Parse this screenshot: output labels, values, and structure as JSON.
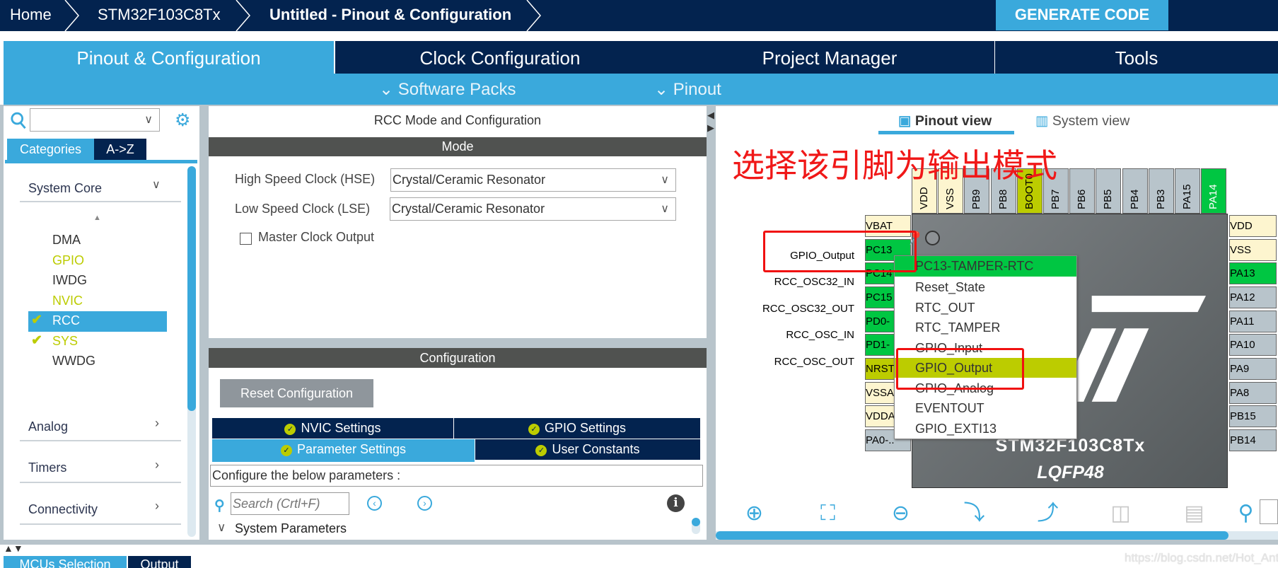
{
  "breadcrumb": [
    "Home",
    "STM32F103C8Tx",
    "Untitled - Pinout & Configuration"
  ],
  "generate_label": "GENERATE CODE",
  "main_tabs": [
    "Pinout & Configuration",
    "Clock Configuration",
    "Project Manager",
    "Tools"
  ],
  "sub_menus": [
    "Software Packs",
    "Pinout"
  ],
  "sidebar": {
    "search_value": "",
    "tabs": [
      "Categories",
      "A->Z"
    ],
    "group": "System Core",
    "items": [
      {
        "label": "DMA",
        "state": "normal"
      },
      {
        "label": "GPIO",
        "state": "warn"
      },
      {
        "label": "IWDG",
        "state": "normal"
      },
      {
        "label": "NVIC",
        "state": "warn"
      },
      {
        "label": "RCC",
        "state": "selected-checked"
      },
      {
        "label": "SYS",
        "state": "checked"
      },
      {
        "label": "WWDG",
        "state": "normal"
      }
    ],
    "categories": [
      "Analog",
      "Timers",
      "Connectivity"
    ]
  },
  "mode": {
    "title": "RCC Mode and Configuration",
    "header": "Mode",
    "hse_label": "High Speed Clock (HSE)",
    "hse_value": "Crystal/Ceramic Resonator",
    "lse_label": "Low Speed Clock (LSE)",
    "lse_value": "Crystal/Ceramic Resonator",
    "mco_label": "Master Clock Output",
    "mco_checked": false
  },
  "config": {
    "header": "Configuration",
    "reset_label": "Reset Configuration",
    "tabs": [
      "NVIC Settings",
      "GPIO Settings",
      "Parameter Settings",
      "User Constants"
    ],
    "hint": "Configure the below parameters :",
    "search_placeholder": "Search (Crtl+F)",
    "section": "System Parameters"
  },
  "pinout": {
    "views": [
      "Pinout view",
      "System view"
    ],
    "annotation": "选择该引脚为输出模式",
    "chip_name": "STM32F103C8Tx",
    "package": "LQFP48",
    "colors": {
      "power": "#fdf5cf",
      "default": "#b8c4cb",
      "assigned": "#00c642",
      "boot": "#bccc00"
    },
    "top_pins": [
      [
        "VDD",
        "power"
      ],
      [
        "VSS",
        "power"
      ],
      [
        "PB9",
        "default"
      ],
      [
        "PB8",
        "default"
      ],
      [
        "BOOT0",
        "boot"
      ],
      [
        "PB7",
        "default"
      ],
      [
        "PB6",
        "default"
      ],
      [
        "PB5",
        "default"
      ],
      [
        "PB4",
        "default"
      ],
      [
        "PB3",
        "default"
      ],
      [
        "PA15",
        "default"
      ],
      [
        "PA14",
        "assigned"
      ]
    ],
    "left_pins": [
      [
        "VBAT",
        "power"
      ],
      [
        "PC13",
        "assigned"
      ],
      [
        "PC14",
        "assigned"
      ],
      [
        "PC15",
        "assigned"
      ],
      [
        "PD0-",
        "assigned"
      ],
      [
        "PD1-",
        "assigned"
      ],
      [
        "NRST",
        "boot"
      ],
      [
        "VSSA",
        "power"
      ],
      [
        "VDDA",
        "power"
      ],
      [
        "PA0-..",
        "default"
      ]
    ],
    "right_pins": [
      [
        "VDD",
        "power"
      ],
      [
        "VSS",
        "power"
      ],
      [
        "PA13",
        "assigned"
      ],
      [
        "PA12",
        "default"
      ],
      [
        "PA11",
        "default"
      ],
      [
        "PA10",
        "default"
      ],
      [
        "PA9",
        "default"
      ],
      [
        "PA8",
        "default"
      ],
      [
        "PB15",
        "default"
      ],
      [
        "PB14",
        "default"
      ]
    ],
    "pin_labels": [
      "GPIO_Output",
      "RCC_OSC32_IN",
      "RCC_OSC32_OUT",
      "RCC_OSC_IN",
      "RCC_OSC_OUT"
    ],
    "menu": {
      "title": "PC13-TAMPER-RTC",
      "items": [
        "Reset_State",
        "RTC_OUT",
        "RTC_TAMPER",
        "GPIO_Input",
        "GPIO_Output",
        "GPIO_Analog",
        "EVENTOUT",
        "GPIO_EXTI13"
      ],
      "selected": "GPIO_Output"
    }
  },
  "bottom_tabs": [
    "MCUs Selection",
    "Output"
  ],
  "watermark": "https://blog.csdn.net/Hot_Ant"
}
